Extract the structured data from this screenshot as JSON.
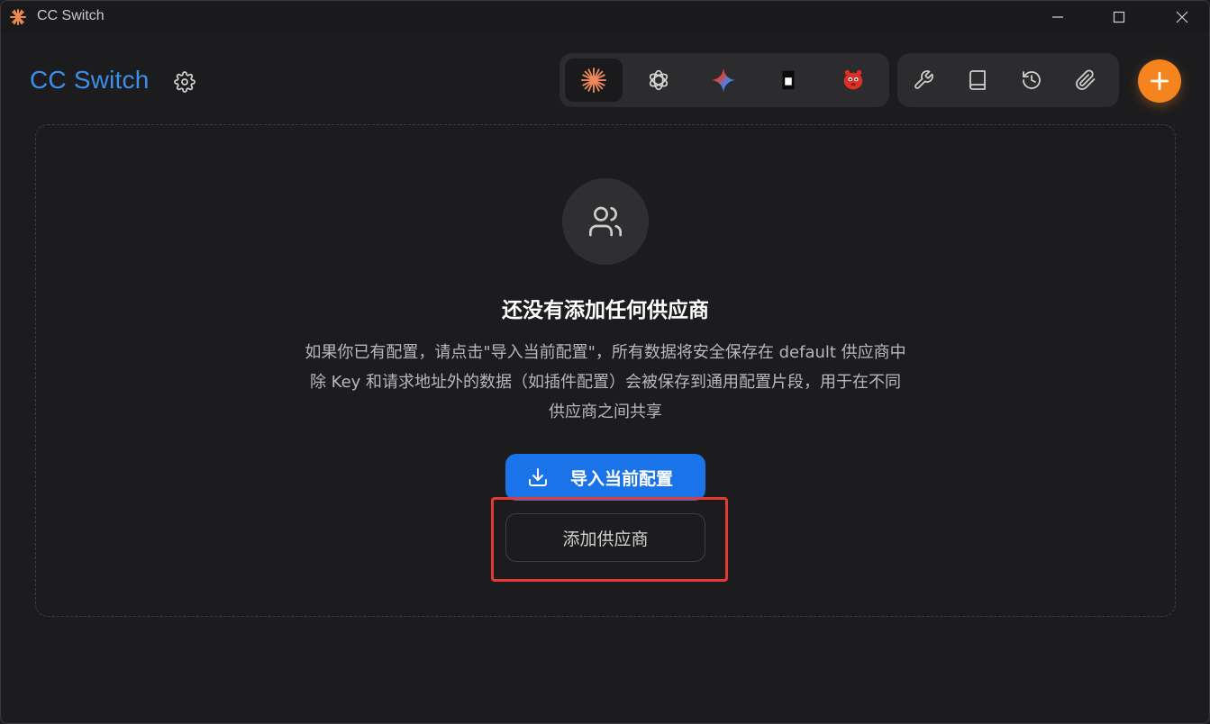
{
  "window": {
    "title": "CC Switch"
  },
  "header": {
    "brand": "CC Switch",
    "icons": {
      "settings": "gear-icon",
      "add": "plus-icon"
    },
    "tabs": [
      {
        "name": "claude",
        "icon": "claude-sparkle-icon",
        "active": true
      },
      {
        "name": "openai",
        "icon": "openai-icon",
        "active": false
      },
      {
        "name": "gemini",
        "icon": "gemini-icon",
        "active": false
      },
      {
        "name": "terminal",
        "icon": "terminal-icon",
        "active": false
      },
      {
        "name": "mascot",
        "icon": "red-mascot-icon",
        "active": false
      }
    ],
    "tools": [
      {
        "name": "tools",
        "icon": "wrench-icon"
      },
      {
        "name": "docs",
        "icon": "book-icon"
      },
      {
        "name": "history",
        "icon": "history-icon"
      },
      {
        "name": "attach",
        "icon": "paperclip-icon"
      }
    ]
  },
  "empty_state": {
    "icon": "users-icon",
    "title": "还没有添加任何供应商",
    "desc_lines": [
      "如果你已有配置，请点击\"导入当前配置\"，所有数据将安全保存在 default 供应商中",
      "除 Key 和请求地址外的数据（如插件配置）会被保存到通用配置片段，用于在不同",
      "供应商之间共享"
    ],
    "import_button": "导入当前配置",
    "add_button": "添加供应商"
  },
  "colors": {
    "brand": "#3b8eea",
    "primary": "#1a73e8",
    "accent": "#f5841f",
    "highlight": "#e53935",
    "background": "#1c1c1e"
  }
}
